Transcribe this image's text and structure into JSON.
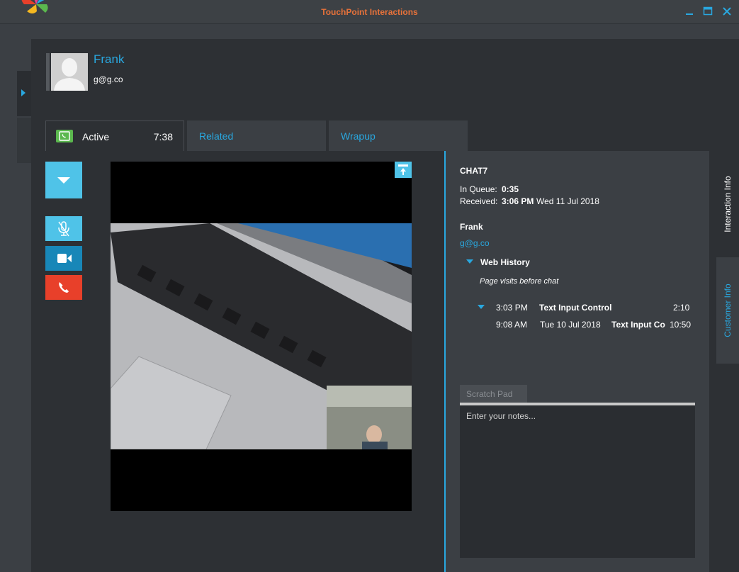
{
  "window": {
    "title": "TouchPoint Interactions",
    "controls": {
      "minimize": "▬",
      "maximize": "□",
      "close": "✕"
    }
  },
  "customer": {
    "name": "Frank",
    "email": "g@g.co"
  },
  "tabs": [
    {
      "label": "Active",
      "timer": "7:38",
      "icon": "phone-icon"
    },
    {
      "label": "Related"
    },
    {
      "label": "Wrapup"
    }
  ],
  "controls": {
    "dropdown": "chevron-down-icon",
    "mute": "mic-muted-icon",
    "video": "video-camera-icon",
    "hangup": "phone-hangup-icon"
  },
  "interaction": {
    "channel": "CHAT7",
    "in_queue_label": "In Queue:",
    "in_queue_value": "0:35",
    "received_label": "Received:",
    "received_time": "3:06 PM",
    "received_date": "Wed 11 Jul 2018",
    "customer_name": "Frank",
    "customer_email": "g@g.co",
    "web_history": {
      "title": "Web History",
      "subtitle": "Page visits before chat",
      "rows": [
        {
          "time": "3:03 PM",
          "date": "",
          "page": "Text Input Control",
          "duration": "2:10"
        },
        {
          "time": "9:08 AM",
          "date": "Tue 10 Jul 2018",
          "page": "Text Input Co",
          "duration": "10:50"
        }
      ]
    }
  },
  "scratch_pad": {
    "tab_label": "Scratch Pad",
    "placeholder": "Enter your notes..."
  },
  "side_tabs": {
    "interaction_info": "Interaction Info",
    "customer_info": "Customer Info"
  },
  "colors": {
    "accent": "#29a8e0",
    "title": "#e8723a",
    "hangup": "#e8402a",
    "active_badge": "#5bb84e"
  }
}
